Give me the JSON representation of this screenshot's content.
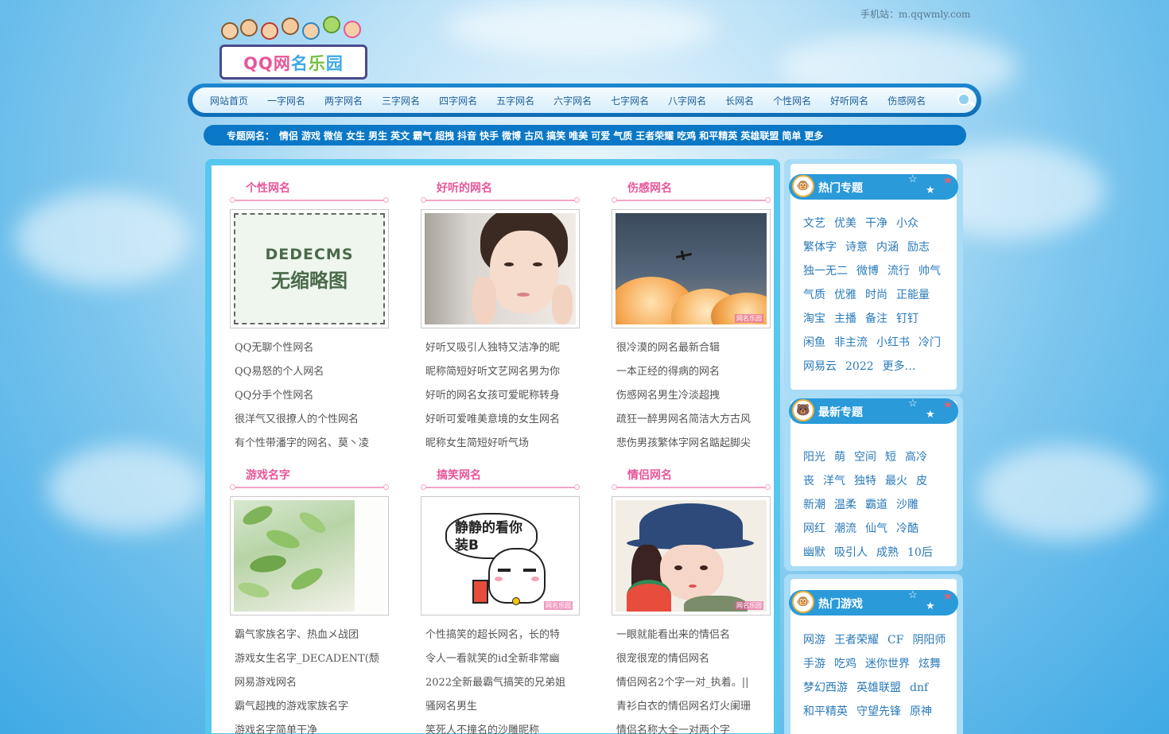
{
  "header": {
    "mobile_label": "手机站：",
    "mobile_url": "m.qqwmly.com",
    "logo_text": [
      "QQ",
      "网",
      "名",
      "乐",
      "园"
    ]
  },
  "nav": {
    "items": [
      "网站首页",
      "一字网名",
      "两字网名",
      "三字网名",
      "四字网名",
      "五字网名",
      "六字网名",
      "七字网名",
      "八字网名",
      "长网名",
      "个性网名",
      "好听网名",
      "伤感网名"
    ]
  },
  "topics": {
    "label": "专题网名：",
    "items": [
      "情侣",
      "游戏",
      "微信",
      "女生",
      "男生",
      "英文",
      "霸气",
      "超拽",
      "抖音",
      "快手",
      "微博",
      "古风",
      "搞笑",
      "唯美",
      "可爱",
      "气质",
      "王者荣耀",
      "吃鸡",
      "和平精英",
      "英雄联盟",
      "简单",
      "更多"
    ]
  },
  "sections": [
    {
      "title": "个性网名",
      "thumb": "placeholder",
      "placeholder_line1": "DEDECMS",
      "placeholder_line2": "无缩略图",
      "items": [
        "QQ无聊个性网名",
        "QQ易怒的个人网名",
        "QQ分手个性网名",
        "很洋气又很撩人的个性网名",
        "有个性带潘字的网名、莫丶凌"
      ]
    },
    {
      "title": "好听的网名",
      "thumb": "girl-portrait",
      "items": [
        "好听又吸引人独特又洁净的昵",
        "昵称简短好听文艺网名男为你",
        "好听的网名女孩可爱昵称转身",
        "好听可爱唯美意境的女生网名",
        "昵称女生简短好听气场"
      ]
    },
    {
      "title": "伤感网名",
      "thumb": "sky-plane",
      "watermark": "网名乐园",
      "items": [
        "很冷漠的网名最新合辑",
        "一本正经的得病的网名",
        "伤感网名男生冷淡超拽",
        "疏狂一醉男网名简洁大方古风",
        "悲伤男孩繁体字网名踮起脚尖"
      ]
    },
    {
      "title": "游戏名字",
      "thumb": "green-leaves",
      "items": [
        "霸气家族名字、热血メ战团",
        "游戏女生名字_DECADENT(颓",
        "网易游戏网名",
        "霸气超拽的游戏家族名字",
        "游戏名字简单干净"
      ]
    },
    {
      "title": "搞笑网名",
      "thumb": "cartoon-cat",
      "bubble_text": [
        "静静的看你",
        "装B"
      ],
      "watermark": "网名乐园",
      "items": [
        "个性搞笑的超长网名，长的特",
        "令人一看就笑的id全新非常幽",
        "2022全新最霸气搞笑的兄弟姐",
        "骚网名男生",
        "笑死人不撞名的沙雕昵称"
      ]
    },
    {
      "title": "情侣网名",
      "thumb": "girl-hat-watermelon",
      "watermark": "网名乐园",
      "items": [
        "一眼就能看出来的情侣名",
        "很宠很宠的情侣网名",
        "情侣网名2个字一对_执着。||",
        "青衫白衣的情侣网名灯火阑珊",
        "情侣名称大全一对两个字"
      ]
    }
  ],
  "sidebar": {
    "hot_topics": {
      "title": "热门专题",
      "icon": "monkey-icon",
      "rows": [
        [
          "文艺",
          "优美",
          "干净",
          "小众"
        ],
        [
          "繁体字",
          "诗意",
          "内涵",
          "励志"
        ],
        [
          "独一无二",
          "微博",
          "流行",
          "帅气"
        ],
        [
          "气质",
          "优雅",
          "时尚",
          "正能量"
        ],
        [
          "淘宝",
          "主播",
          "备注",
          "钉钉"
        ],
        [
          "闲鱼",
          "非主流",
          "小红书",
          "冷门"
        ],
        [
          "网易云",
          "2022",
          "更多…"
        ]
      ]
    },
    "new_topics": {
      "title": "最新专题",
      "icon": "bear-icon",
      "rows": [
        [
          "阳光",
          "萌",
          "空间",
          "短",
          "高冷"
        ],
        [
          "丧",
          "洋气",
          "独特",
          "最火",
          "皮"
        ],
        [
          "新潮",
          "温柔",
          "霸道",
          "沙雕"
        ],
        [
          "网红",
          "潮流",
          "仙气",
          "冷酷"
        ],
        [
          "幽默",
          "吸引人",
          "成熟",
          "10后"
        ]
      ]
    },
    "hot_games": {
      "title": "热门游戏",
      "icon": "monkey-icon",
      "rows": [
        [
          "网游",
          "王者荣耀",
          "CF",
          "阴阳师"
        ],
        [
          "手游",
          "吃鸡",
          "迷你世界",
          "炫舞"
        ],
        [
          "梦幻西游",
          "英雄联盟",
          "dnf"
        ],
        [
          "和平精英",
          "守望先锋",
          "原神"
        ]
      ]
    }
  },
  "colors": {
    "nav_blue": "#0e6db6",
    "section_pink": "#e8569a",
    "tag_blue": "#2a7ab8",
    "panel_cyan": "#56c8ee"
  }
}
